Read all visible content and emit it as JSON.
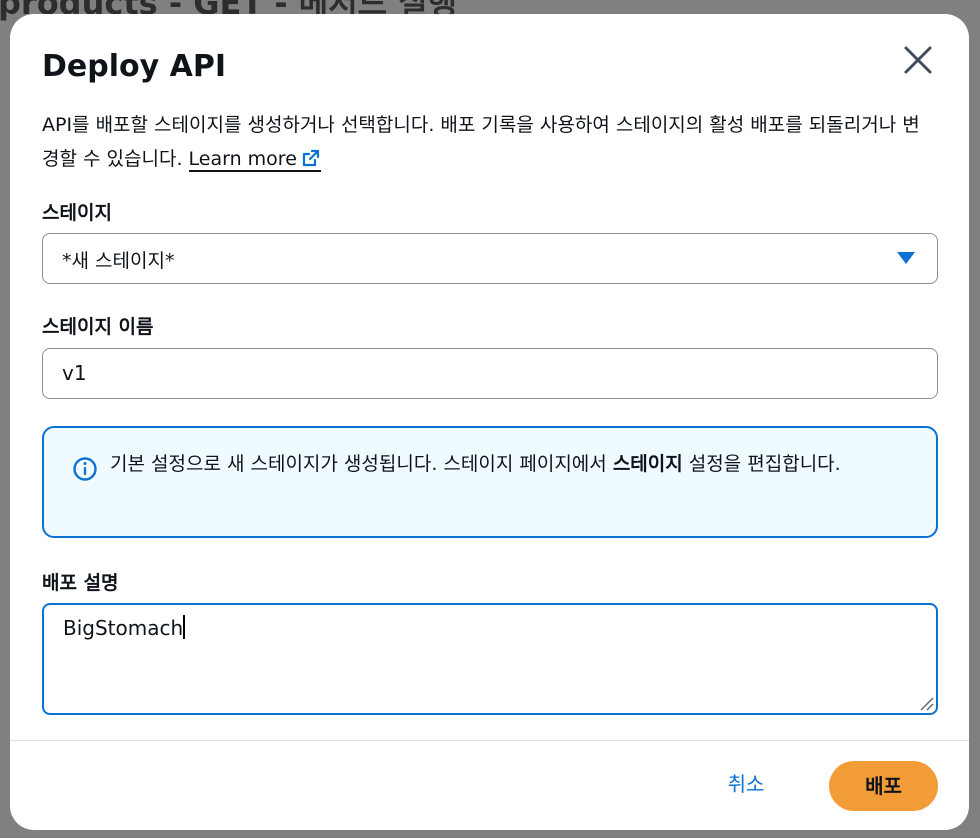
{
  "background": {
    "title": "products - GET - 메서드 실행"
  },
  "modal": {
    "title": "Deploy API",
    "description": "API를 배포할 스테이지를 생성하거나 선택합니다. 배포 기록을 사용하여 스테이지의 활성 배포를 되돌리거나 변경할 수 있습니다.",
    "learn_more": "Learn more",
    "stage": {
      "label": "스테이지",
      "selected": "*새 스테이지*"
    },
    "stage_name": {
      "label": "스테이지 이름",
      "value": "v1"
    },
    "info": {
      "text_before": "기본 설정으로 새 스테이지가 생성됩니다. 스테이지 페이지에서 ",
      "text_bold": "스테이지",
      "text_after": " 설정을 편집합니다."
    },
    "deployment_description": {
      "label": "배포 설명",
      "value": "BigStomach"
    },
    "buttons": {
      "cancel": "취소",
      "deploy": "배포"
    }
  },
  "colors": {
    "accent": "#0972d3",
    "primary_button": "#f29c37",
    "info_background": "#f0fbff"
  },
  "icons": [
    "close-icon",
    "external-link-icon",
    "chevron-down-icon",
    "info-icon",
    "resize-grip-icon"
  ]
}
